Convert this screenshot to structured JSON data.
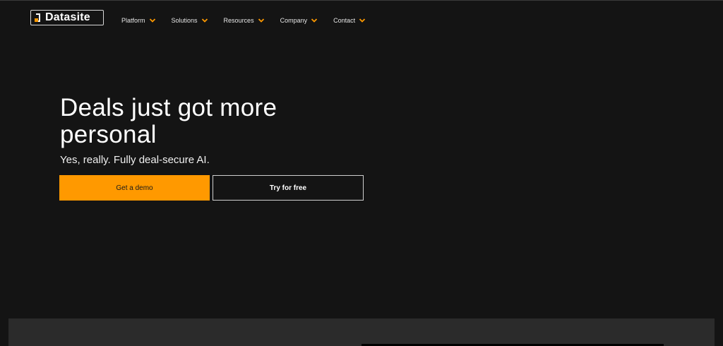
{
  "brand": {
    "name": "Datasite",
    "accent_color": "#ff9900",
    "background_color": "#141414"
  },
  "nav": {
    "items": [
      {
        "label": "Platform",
        "icon": "chevron-down-icon"
      },
      {
        "label": "Solutions",
        "icon": "chevron-down-icon"
      },
      {
        "label": "Resources",
        "icon": "chevron-down-icon"
      },
      {
        "label": "Company",
        "icon": "chevron-down-icon"
      },
      {
        "label": "Contact",
        "icon": "chevron-down-icon"
      }
    ]
  },
  "hero": {
    "title_line1": "Deals just got more",
    "title_line2": "personal",
    "subtitle": "Yes, really. Fully deal-secure AI.",
    "primary_button": "Get a demo",
    "secondary_button": "Try for free"
  }
}
